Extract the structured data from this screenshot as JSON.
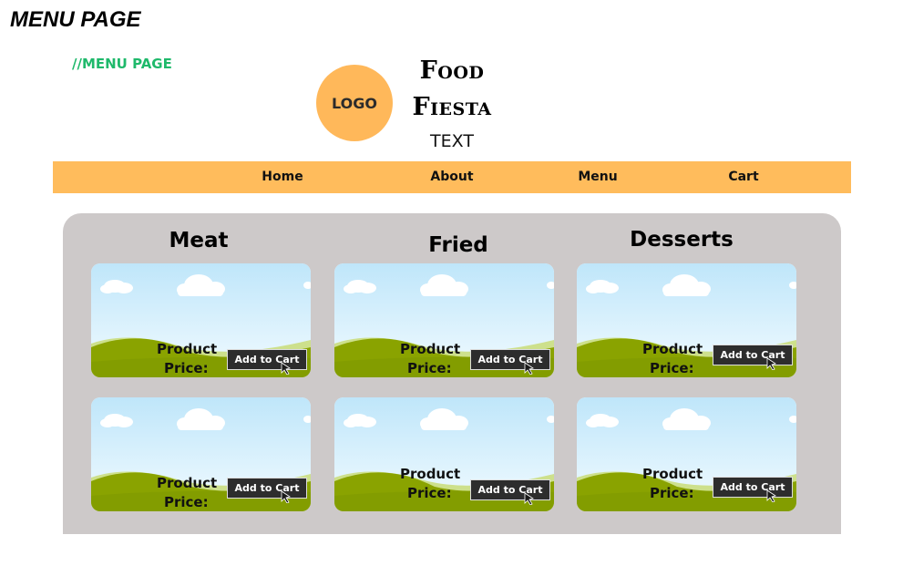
{
  "page_title": "MENU PAGE",
  "comment": "//MENU PAGE",
  "header": {
    "logo_label": "LOGO",
    "brand_line1": "Food",
    "brand_line2": "Fiesta",
    "brand_sub": "TEXT"
  },
  "nav": {
    "items": [
      {
        "label": "Home"
      },
      {
        "label": "About"
      },
      {
        "label": "Menu"
      },
      {
        "label": "Cart"
      }
    ]
  },
  "categories": [
    {
      "title": "Meat"
    },
    {
      "title": "Fried"
    },
    {
      "title": "Desserts"
    }
  ],
  "product": {
    "name": "Product",
    "price_label": "Price:",
    "button_label": "Add to Cart"
  },
  "colors": {
    "accent": "#ffbc5c",
    "logo": "#ffb85a",
    "panel": "#cdc9c9",
    "comment": "#1fb96b",
    "grass": "#8aa300",
    "sky": "#bfe6fa"
  }
}
